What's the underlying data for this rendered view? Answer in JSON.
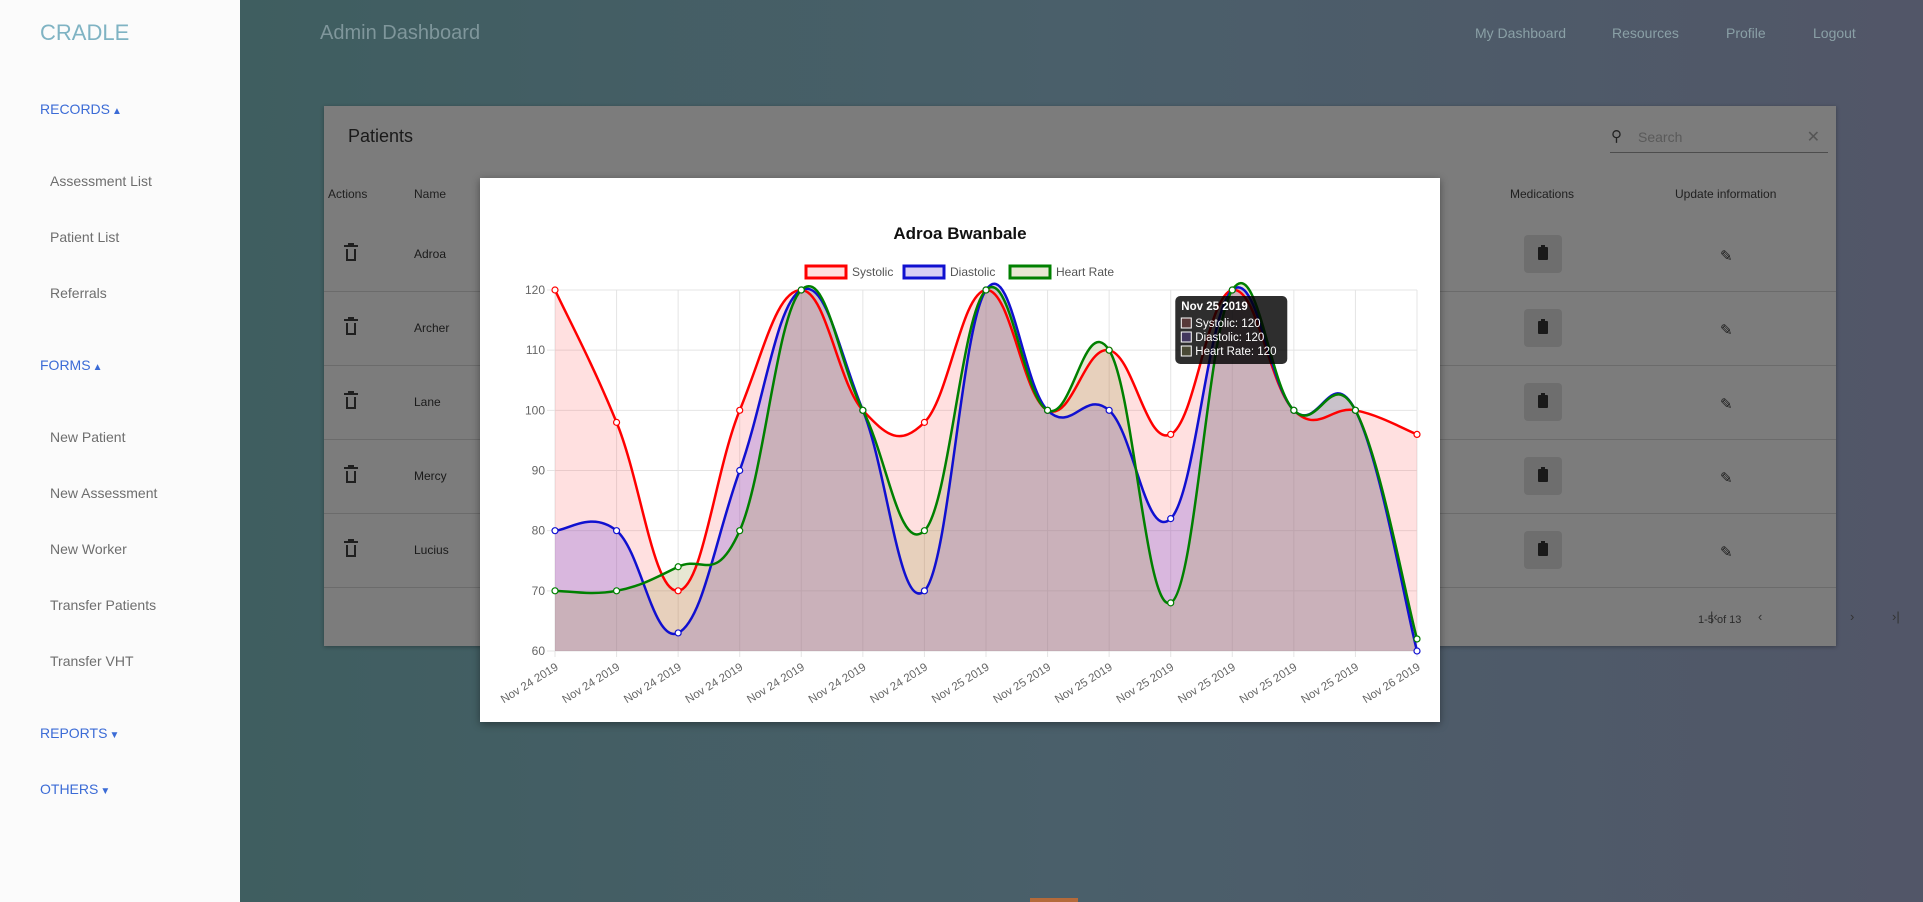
{
  "sidebar": {
    "brand": "CRADLE",
    "sections": [
      {
        "label": "RECORDS",
        "caret": "▲",
        "items": [
          "Assessment List",
          "Patient List",
          "Referrals"
        ]
      },
      {
        "label": "FORMS",
        "caret": "▲",
        "items": [
          "New Patient",
          "New Assessment",
          "New Worker",
          "Transfer Patients",
          "Transfer VHT"
        ]
      },
      {
        "label": "REPORTS",
        "caret": "▼",
        "items": []
      },
      {
        "label": "OTHERS",
        "caret": "▼",
        "items": []
      }
    ]
  },
  "header": {
    "title": "Admin Dashboard",
    "nav": [
      "My Dashboard",
      "Resources",
      "Profile",
      "Logout"
    ]
  },
  "patients_table": {
    "title": "Patients",
    "search_placeholder": "Search",
    "columns": [
      "Actions",
      "Name",
      "Medications",
      "Update information"
    ],
    "rows": [
      {
        "name": "Adroa"
      },
      {
        "name": "Archer"
      },
      {
        "name": "Lane"
      },
      {
        "name": "Mercy"
      },
      {
        "name": "Lucius"
      }
    ],
    "pagination": "1-5 of 13"
  },
  "icons": {
    "search": "search-icon",
    "clear": "close-icon",
    "delete": "trash-icon",
    "medications": "clipboard-icon",
    "edit": "pencil-icon"
  },
  "chart_data": {
    "type": "line",
    "title": "Adroa Bwanbale",
    "categories": [
      "Nov 24 2019",
      "Nov 24 2019",
      "Nov 24 2019",
      "Nov 24 2019",
      "Nov 24 2019",
      "Nov 24 2019",
      "Nov 24 2019",
      "Nov 25 2019",
      "Nov 25 2019",
      "Nov 25 2019",
      "Nov 25 2019",
      "Nov 25 2019",
      "Nov 25 2019",
      "Nov 25 2019",
      "Nov 26 2019"
    ],
    "series": [
      {
        "name": "Systolic",
        "color": "#ff0000",
        "fill": "rgba(255,99,99,0.2)",
        "values": [
          120,
          98,
          70,
          100,
          120,
          100,
          98,
          120,
          100,
          110,
          96,
          120,
          100,
          100,
          96
        ]
      },
      {
        "name": "Diastolic",
        "color": "#1010d0",
        "fill": "rgba(120,80,220,0.28)",
        "values": [
          80,
          80,
          63,
          90,
          120,
          100,
          70,
          120,
          100,
          100,
          82,
          120,
          100,
          100,
          60
        ]
      },
      {
        "name": "Heart Rate",
        "color": "#008000",
        "fill": "rgba(160,160,80,0.25)",
        "values": [
          70,
          70,
          74,
          80,
          120,
          100,
          80,
          120,
          100,
          110,
          68,
          120,
          100,
          100,
          62
        ]
      }
    ],
    "ylim": [
      60,
      120
    ],
    "yticks": [
      60,
      70,
      80,
      90,
      100,
      110,
      120
    ],
    "grid": true,
    "legend": "top",
    "tooltip": {
      "index": 11,
      "title": "Nov 25 2019",
      "lines": [
        "Systolic: 120",
        "Diastolic: 120",
        "Heart Rate: 120"
      ]
    }
  }
}
